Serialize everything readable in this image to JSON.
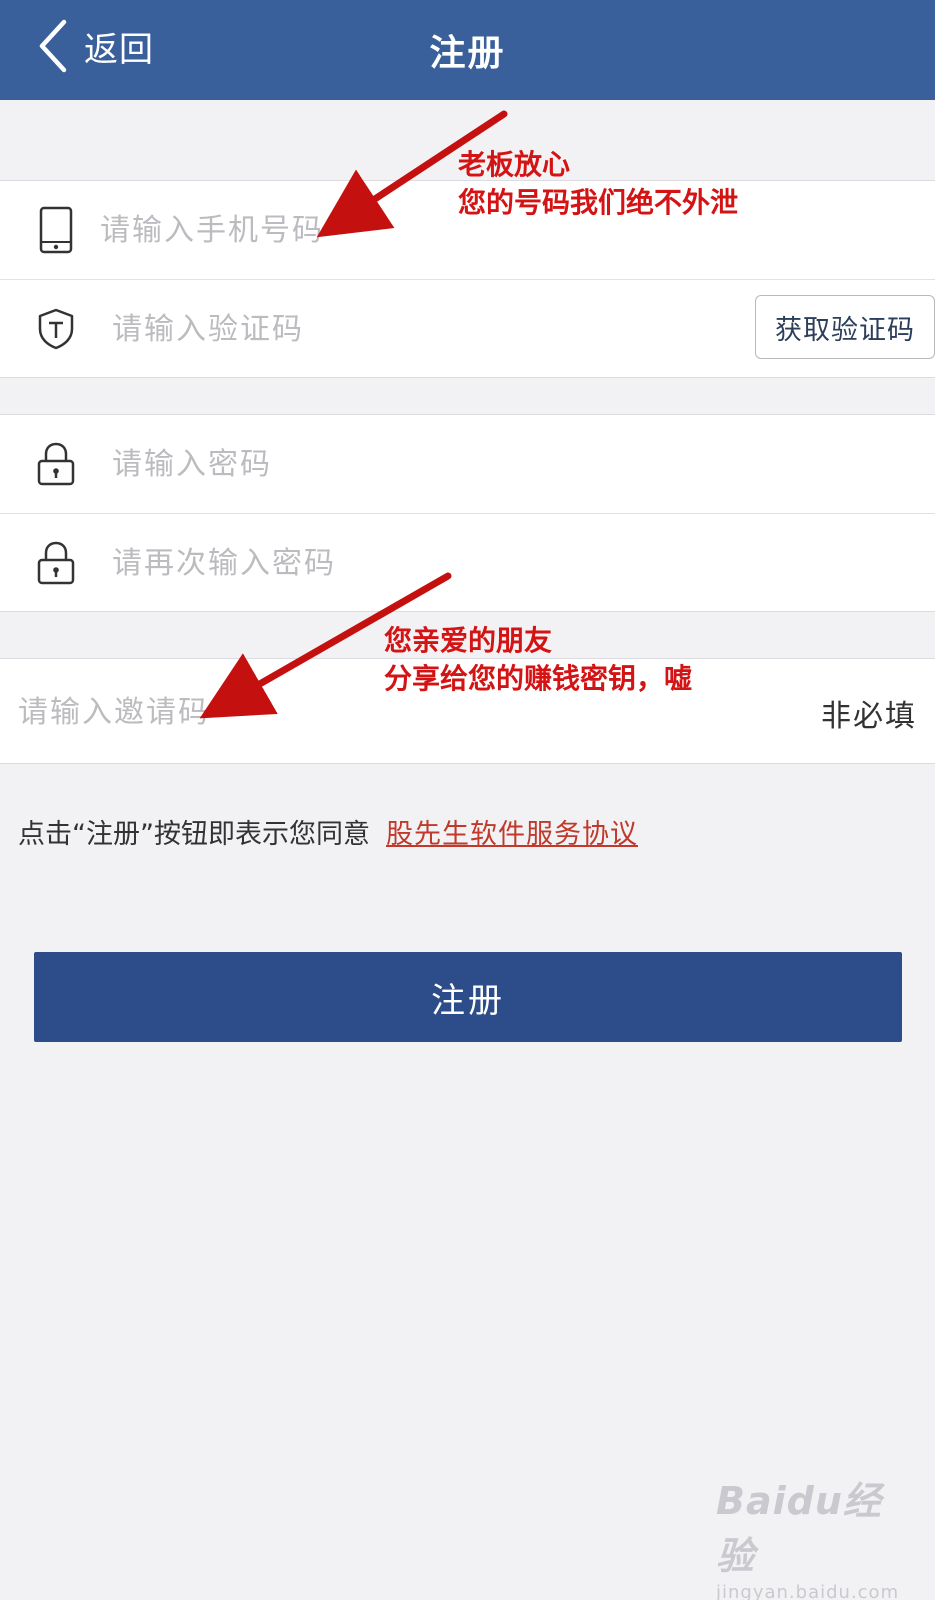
{
  "header": {
    "back_label": "返回",
    "title": "注册"
  },
  "form": {
    "phone": {
      "placeholder": "请输入手机号码",
      "icon": "phone-icon"
    },
    "verify": {
      "placeholder": "请输入验证码",
      "icon": "shield-t-icon",
      "button_label": "获取验证码"
    },
    "password": {
      "placeholder": "请输入密码",
      "icon": "lock-icon"
    },
    "password_confirm": {
      "placeholder": "请再次输入密码",
      "icon": "lock-icon"
    },
    "invite": {
      "placeholder": "请输入邀请码",
      "optional_label": "非必填"
    }
  },
  "agreement": {
    "text": "点击“注册”按钮即表示您同意",
    "link_label": "股先生软件服务协议"
  },
  "submit_label": "注册",
  "annotations": {
    "phone_line1": "老板放心",
    "phone_line2": "您的号码我们绝不外泄",
    "invite_line1": "您亲爱的朋友",
    "invite_line2": "分享给您的赚钱密钥，嘘"
  },
  "watermark": {
    "main": "Baidu经验",
    "sub": "jingyan.baidu.com"
  },
  "colors": {
    "header": "#3a609b",
    "submit": "#2c4d8a",
    "link": "#c0392b",
    "annotation": "#d41414"
  }
}
